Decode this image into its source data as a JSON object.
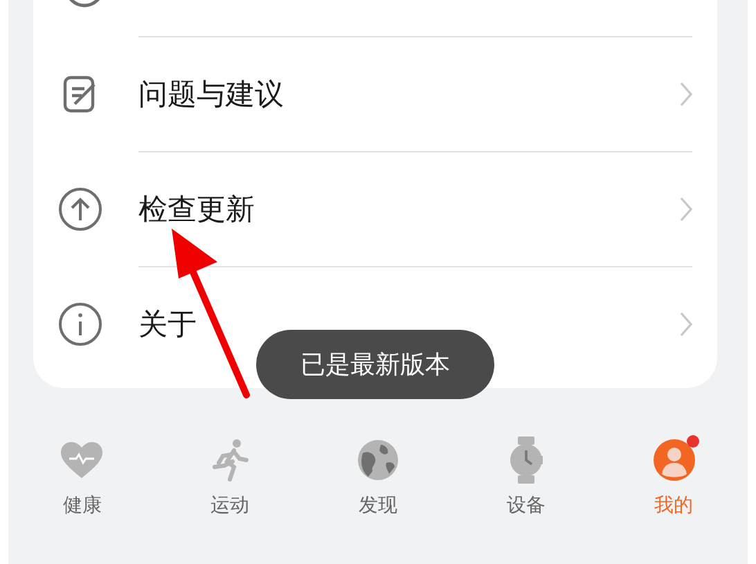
{
  "menu": [
    {
      "kind": "feedback",
      "label": "问题与建议"
    },
    {
      "kind": "update",
      "label": "检查更新"
    },
    {
      "kind": "about",
      "label": "关于"
    }
  ],
  "toast": "已是最新版本",
  "tabs": [
    {
      "kind": "health",
      "label": "健康",
      "selected": false,
      "badge": false
    },
    {
      "kind": "sport",
      "label": "运动",
      "selected": false,
      "badge": false
    },
    {
      "kind": "discover",
      "label": "发现",
      "selected": false,
      "badge": false
    },
    {
      "kind": "device",
      "label": "设备",
      "selected": false,
      "badge": false
    },
    {
      "kind": "me",
      "label": "我的",
      "selected": true,
      "badge": true
    }
  ]
}
